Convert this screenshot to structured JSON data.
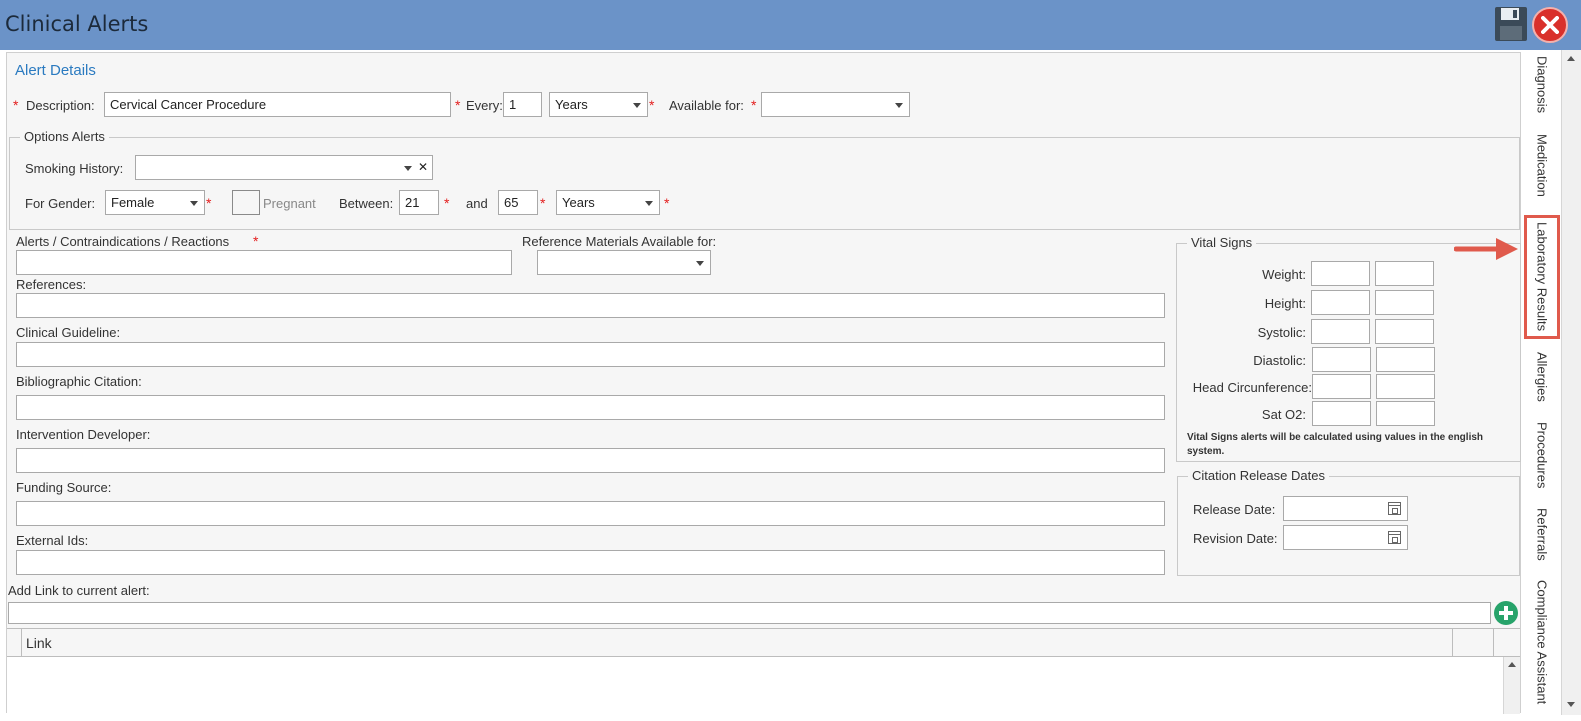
{
  "window": {
    "title": "Clinical Alerts"
  },
  "alert_details": {
    "section_title": "Alert Details",
    "description_label": "Description:",
    "description_value": "Cervical Cancer Procedure",
    "every_label": "Every:",
    "every_value": "1",
    "every_unit": "Years",
    "available_for_label": "Available for:",
    "available_for_value": "",
    "required_mark": "*"
  },
  "options_alerts": {
    "legend": "Options Alerts",
    "smoking_history_label": "Smoking History:",
    "smoking_history_value": "",
    "clear_glyph": "✕",
    "for_gender_label": "For Gender:",
    "for_gender_value": "Female",
    "pregnant_label": "Pregnant",
    "between_label": "Between:",
    "age_from": "21",
    "and_label": "and",
    "age_to": "65",
    "age_unit": "Years"
  },
  "form": {
    "alerts_label": "Alerts / Contraindications / Reactions",
    "reference_materials_label": "Reference Materials Available for:",
    "references_label": "References:",
    "clinical_guideline_label": "Clinical Guideline:",
    "bibliographic_citation_label": "Bibliographic Citation:",
    "intervention_developer_label": "Intervention Developer:",
    "funding_source_label": "Funding Source:",
    "external_ids_label": "External Ids:",
    "add_link_label": "Add Link to current alert:"
  },
  "vital_signs": {
    "legend": "Vital Signs",
    "rows": [
      "Weight:",
      "Height:",
      "Systolic:",
      "Diastolic:",
      "Head Circunference:",
      "Sat O2:"
    ],
    "note": "Vital Signs alerts will be calculated using values in the english system."
  },
  "citation_dates": {
    "legend": "Citation Release Dates",
    "release_date_label": "Release Date:",
    "revision_date_label": "Revision Date:"
  },
  "link_grid": {
    "column_header": "Link"
  },
  "sidebar_tabs": [
    "Diagnosis",
    "Medication",
    "Laboratory Results",
    "Allergies",
    "Procedures",
    "Referrals",
    "Compliance Assistant"
  ],
  "colors": {
    "titlebar": "#6b93c8",
    "accent": "#2a7ac0",
    "required": "#e31d1d",
    "highlight": "#e05a4c"
  }
}
